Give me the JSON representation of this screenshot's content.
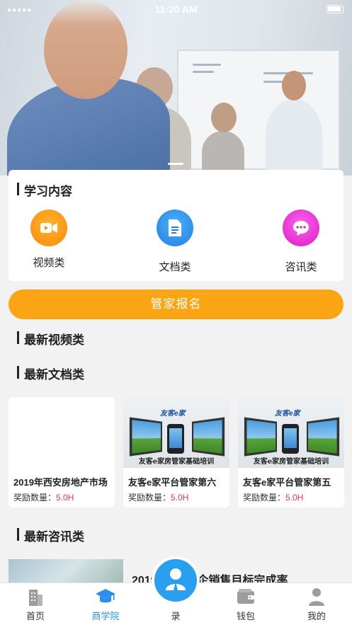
{
  "status_bar": {
    "time": "11:20 AM",
    "signal": "●●●●●"
  },
  "learning": {
    "title": "学习内容",
    "categories": [
      {
        "label": "视频类",
        "icon": "video-icon",
        "color": "#fb9a16"
      },
      {
        "label": "文档类",
        "icon": "document-icon",
        "color": "#2f8fe8"
      },
      {
        "label": "咨讯类",
        "icon": "chat-icon",
        "color": "#e92fd0"
      }
    ]
  },
  "signup_button": "管家报名",
  "sections": {
    "latest_video": "最新视频类",
    "latest_doc": "最新文档类",
    "latest_news": "最新咨讯类"
  },
  "docs": [
    {
      "title": "2019年西安房地产市场",
      "reward_label": "奖励数量：",
      "reward_value": "5.0H",
      "thumb": ""
    },
    {
      "title": "友客e家平台管家第六",
      "reward_label": "奖励数量：",
      "reward_value": "5.0H",
      "thumb_logo": "友客e家",
      "thumb_caption": "友客e家房管家基础培训"
    },
    {
      "title": "友客e家平台管家第五",
      "reward_label": "奖励数量：",
      "reward_value": "5.0H",
      "thumb_logo": "友客e家",
      "thumb_caption": "友客e家房管家基础培训"
    }
  ],
  "news": [
    {
      "title": "2019年1月房企销售目标完成率"
    }
  ],
  "tabbar": {
    "items": [
      {
        "label": "首页",
        "icon": "building-icon"
      },
      {
        "label": "商学院",
        "icon": "graduation-cap-icon",
        "active": true
      },
      {
        "label": "录",
        "icon": "agent-icon"
      },
      {
        "label": "钱包",
        "icon": "wallet-icon"
      },
      {
        "label": "我的",
        "icon": "profile-icon"
      }
    ]
  },
  "colors": {
    "accent": "#fba414",
    "active_tab": "#2f8fe8",
    "reward_value": "#e8364a"
  }
}
